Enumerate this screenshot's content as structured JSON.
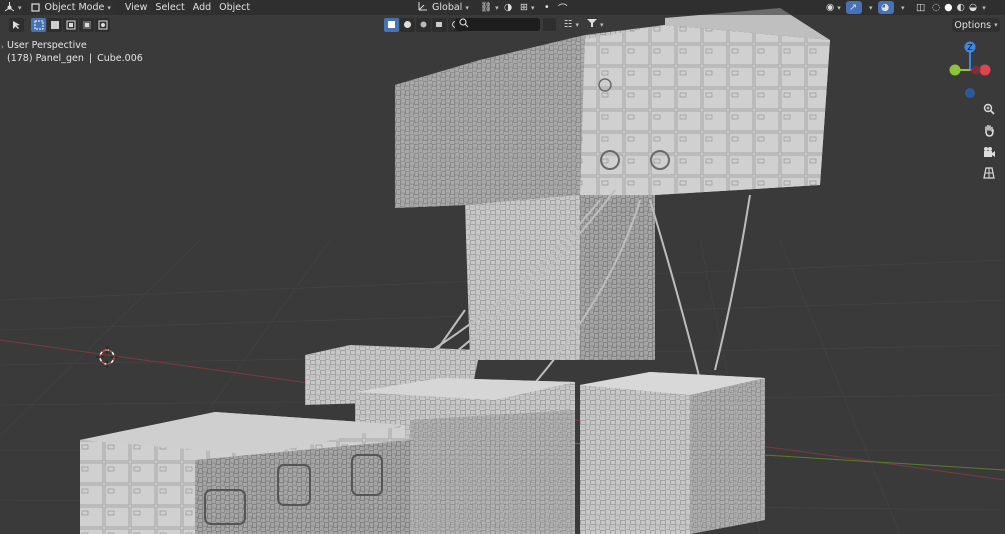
{
  "header": {
    "mode_label": "Object Mode",
    "menus": [
      "View",
      "Select",
      "Add",
      "Object"
    ],
    "transform_orientation": "Global"
  },
  "search": {
    "placeholder": ""
  },
  "options_label": "Options",
  "viewport": {
    "perspective_label": "User Perspective",
    "object_info_prefix": "(178) Panel_gen",
    "object_info_suffix": "Cube.006"
  },
  "gizmo": {
    "z_label": "Z",
    "y_label": "Y",
    "x_label": "X"
  },
  "colors": {
    "accent": "#4772b3",
    "x_axis": "#e0454f",
    "y_axis": "#8cc43a",
    "z_axis": "#3a89e8",
    "header_bg": "#303030"
  },
  "icons": {
    "editor_type": "cube-gizmo-icon",
    "select": "cursor-arrow-icon",
    "zoom": "zoom-icon",
    "pan": "hand-icon",
    "camera": "camera-icon",
    "ortho": "grid-perspective-icon"
  }
}
